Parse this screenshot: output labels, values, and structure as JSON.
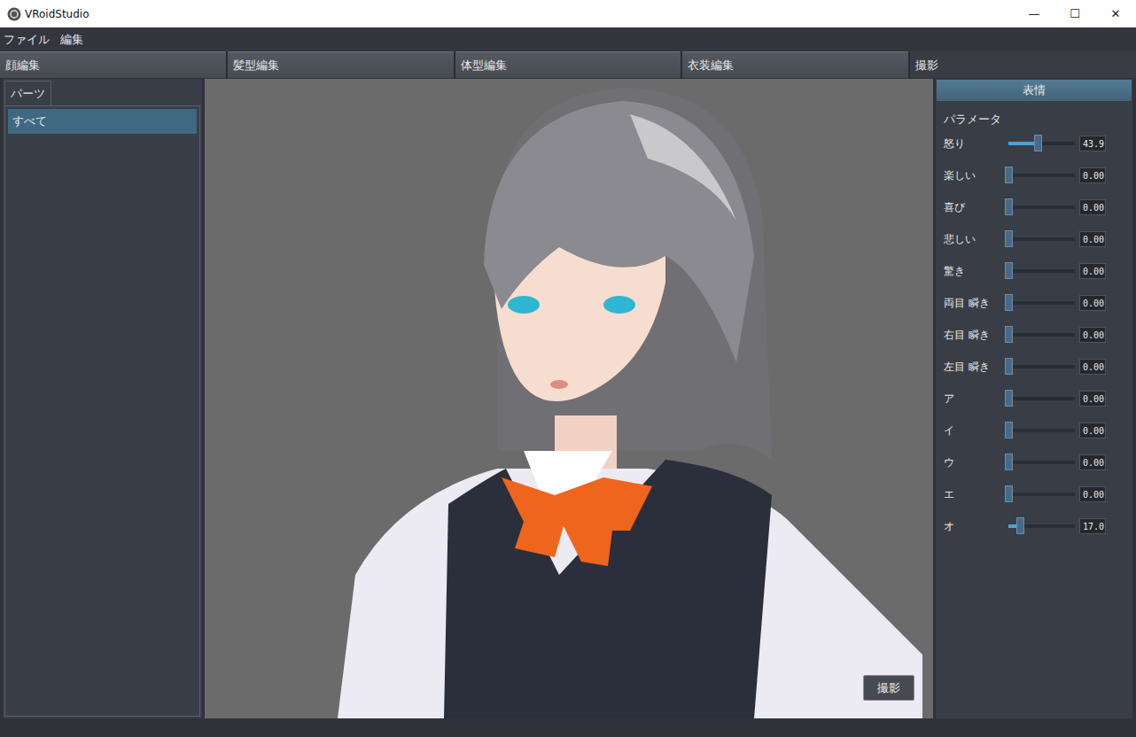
{
  "window": {
    "title": "VRoidStudio",
    "controls": [
      "—",
      "☐",
      "✕"
    ]
  },
  "menu": [
    "ファイル",
    "編集"
  ],
  "tabs": [
    {
      "label": "顔編集",
      "selected": false
    },
    {
      "label": "髪型編集",
      "selected": false
    },
    {
      "label": "体型編集",
      "selected": false
    },
    {
      "label": "衣装編集",
      "selected": false
    },
    {
      "label": "撮影",
      "selected": true
    }
  ],
  "sidebar": {
    "tabs": [
      {
        "label": "パーツ",
        "selected": true
      }
    ],
    "items": [
      {
        "label": "すべて",
        "selected": true
      }
    ]
  },
  "viewport": {
    "button": "撮影"
  },
  "panel": {
    "header": "表情",
    "section": "パラメータ",
    "sliders": [
      {
        "label": "怒り",
        "level": 0.439,
        "reading": "43.9"
      },
      {
        "label": "楽しい",
        "level": 0,
        "reading": "0.00"
      },
      {
        "label": "喜び",
        "level": 0,
        "reading": "0.00"
      },
      {
        "label": "悲しい",
        "level": 0,
        "reading": "0.00"
      },
      {
        "label": "驚き",
        "level": 0,
        "reading": "0.00"
      },
      {
        "label": "両目 瞬き",
        "level": 0,
        "reading": "0.00"
      },
      {
        "label": "右目 瞬き",
        "level": 0,
        "reading": "0.00"
      },
      {
        "label": "左目 瞬き",
        "level": 0,
        "reading": "0.00"
      },
      {
        "label": "ア",
        "level": 0,
        "reading": "0.00"
      },
      {
        "label": "イ",
        "level": 0,
        "reading": "0.00"
      },
      {
        "label": "ウ",
        "level": 0,
        "reading": "0.00"
      },
      {
        "label": "エ",
        "level": 0,
        "reading": "0.00"
      },
      {
        "label": "オ",
        "level": 0.17,
        "reading": "17.0"
      }
    ]
  }
}
